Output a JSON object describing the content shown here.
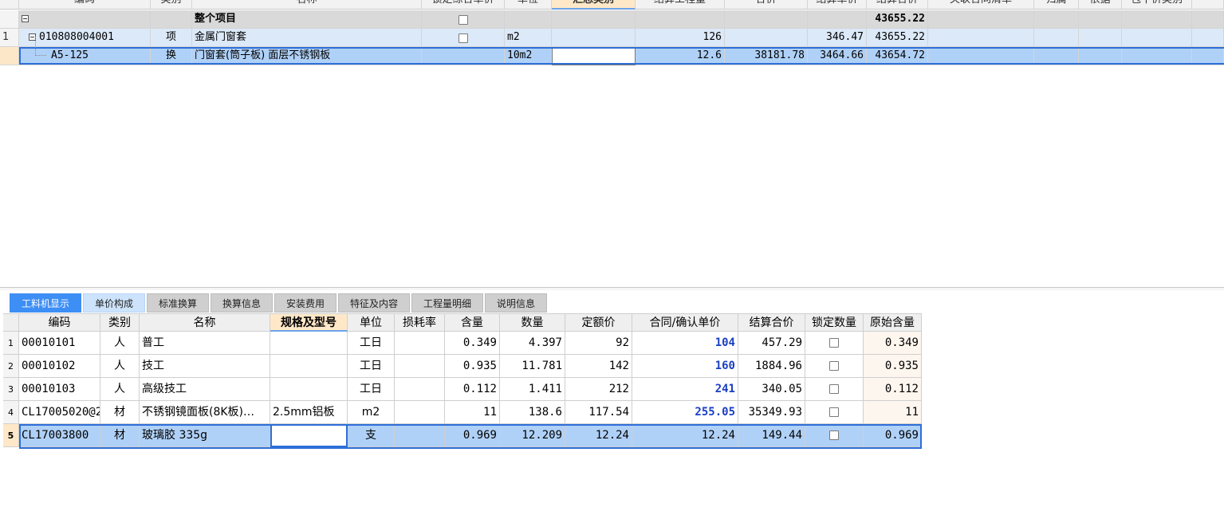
{
  "top_grid": {
    "headers": [
      "编码",
      "类别",
      "名称",
      "锁定综合单价",
      "单位",
      "汇总类别",
      "结算工程量",
      "合价",
      "结算单价",
      "结算合价",
      "关联合同清单",
      "归属",
      "依据",
      "包干价类别"
    ],
    "rows": [
      {
        "num": "",
        "code": "",
        "type": "",
        "name": "整个项目",
        "unit": "",
        "qty": "",
        "hejia": "",
        "price": "",
        "total": "43655.22"
      },
      {
        "num": "1",
        "code": "010808004001",
        "type": "项",
        "name": "金属门窗套",
        "unit": "m2",
        "qty": "126",
        "hejia": "",
        "price": "346.47",
        "total": "43655.22"
      },
      {
        "num": "",
        "code": "A5-125",
        "type": "换",
        "name": "门窗套(筒子板) 面层不锈钢板",
        "unit": "10m2",
        "qty": "12.6",
        "hejia": "38181.78",
        "price": "3464.66",
        "total": "43654.72"
      }
    ]
  },
  "tabs": [
    "工料机显示",
    "单价构成",
    "标准换算",
    "换算信息",
    "安装费用",
    "特征及内容",
    "工程量明细",
    "说明信息"
  ],
  "bottom_grid": {
    "headers": [
      "编码",
      "类别",
      "名称",
      "规格及型号",
      "单位",
      "损耗率",
      "含量",
      "数量",
      "定额价",
      "合同/确认单价",
      "结算合价",
      "锁定数量",
      "原始含量"
    ],
    "rows": [
      {
        "num": "1",
        "code": "00010101",
        "type": "人",
        "name": "普工",
        "spec": "",
        "unit": "工日",
        "loss": "",
        "content": "0.349",
        "qty": "4.397",
        "quota": "92",
        "price": "104",
        "total": "457.29",
        "orig": "0.349"
      },
      {
        "num": "2",
        "code": "00010102",
        "type": "人",
        "name": "技工",
        "spec": "",
        "unit": "工日",
        "loss": "",
        "content": "0.935",
        "qty": "11.781",
        "quota": "142",
        "price": "160",
        "total": "1884.96",
        "orig": "0.935"
      },
      {
        "num": "3",
        "code": "00010103",
        "type": "人",
        "name": "高级技工",
        "spec": "",
        "unit": "工日",
        "loss": "",
        "content": "0.112",
        "qty": "1.411",
        "quota": "212",
        "price": "241",
        "total": "340.05",
        "orig": "0.112"
      },
      {
        "num": "4",
        "code": "CL17005020@2",
        "type": "材",
        "name": "不锈钢镜面板(8K板)…",
        "spec": "2.5mm铝板",
        "unit": "m2",
        "loss": "",
        "content": "11",
        "qty": "138.6",
        "quota": "117.54",
        "price": "255.05",
        "total": "35349.93",
        "orig": "11"
      },
      {
        "num": "5",
        "code": "CL17003800",
        "type": "材",
        "name": "玻璃胶 335g",
        "spec": "",
        "unit": "支",
        "loss": "",
        "content": "0.969",
        "qty": "12.209",
        "quota": "12.24",
        "price": "12.24",
        "total": "149.44",
        "orig": "0.969"
      }
    ]
  }
}
